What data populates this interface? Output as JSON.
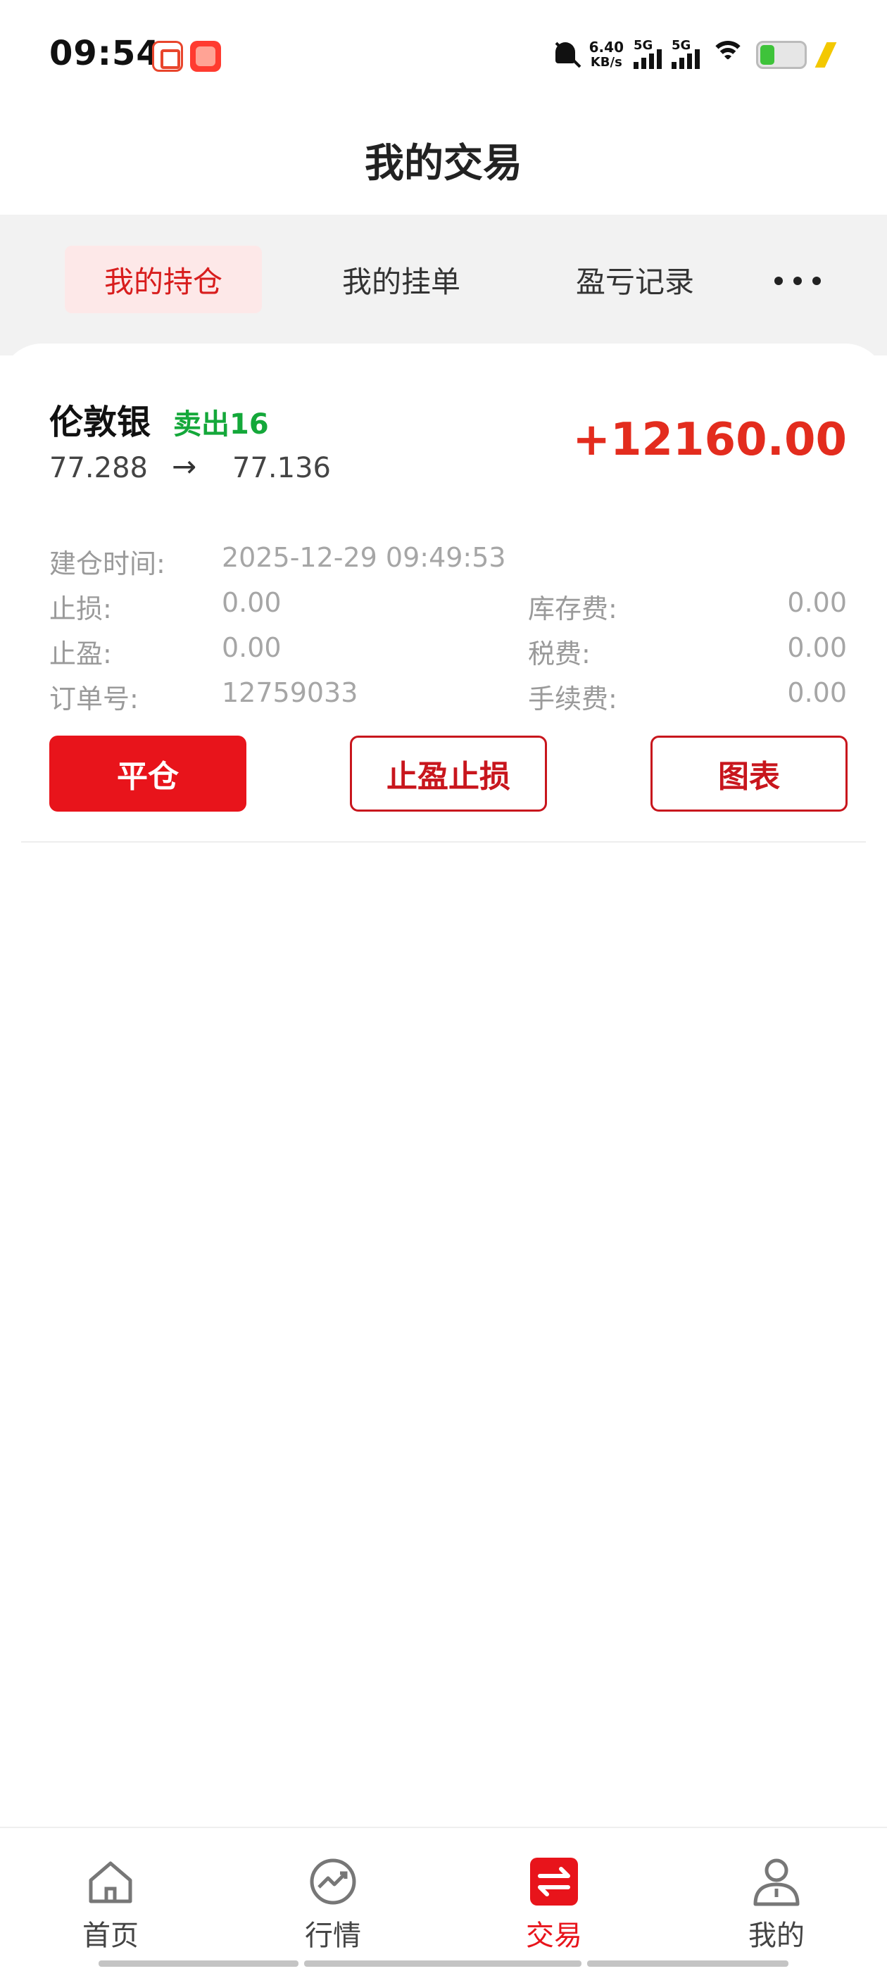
{
  "status_bar": {
    "time": "09:54",
    "net_speed_value": "6.40",
    "net_speed_unit": "KB/s",
    "sim1_label": "5G",
    "sim2_label": "5G",
    "icons": [
      "taobao-app-icon",
      "taobao-shop-icon",
      "bell-muted-icon",
      "signal-icon",
      "wifi-icon",
      "battery-icon",
      "charging-icon"
    ],
    "battery_color": "#3ec33a"
  },
  "header": {
    "title": "我的交易"
  },
  "tabs": [
    {
      "label": "我的持仓",
      "active": true
    },
    {
      "label": "我的挂单",
      "active": false
    },
    {
      "label": "盈亏记录",
      "active": false
    }
  ],
  "position": {
    "symbol": "伦敦银",
    "direction": "卖出16",
    "open_price": "77.288",
    "arrow": "→",
    "current_price": "77.136",
    "pnl": "+12160.00",
    "details": {
      "open_time_label": "建仓时间:",
      "open_time": "2025-12-29 09:49:53",
      "stop_loss_label": "止损:",
      "stop_loss": "0.00",
      "take_profit_label": "止盈:",
      "take_profit": "0.00",
      "order_no_label": "订单号:",
      "order_no": "12759033",
      "storage_fee_label": "库存费:",
      "storage_fee": "0.00",
      "tax_label": "税费:",
      "tax": "0.00",
      "commission_label": "手续费:",
      "commission": "0.00"
    },
    "buttons": {
      "close": "平仓",
      "tp_sl": "止盈止损",
      "chart": "图表"
    }
  },
  "colors": {
    "accent_red": "#e8141b",
    "profit_red": "#e32c1e",
    "sell_green": "#14a83a",
    "tab_active_bg": "#fde8e8"
  },
  "bottom_nav": [
    {
      "label": "首页",
      "icon": "home-icon",
      "active": false
    },
    {
      "label": "行情",
      "icon": "market-trend-icon",
      "active": false
    },
    {
      "label": "交易",
      "icon": "exchange-arrows-icon",
      "active": true
    },
    {
      "label": "我的",
      "icon": "user-icon",
      "active": false
    }
  ]
}
